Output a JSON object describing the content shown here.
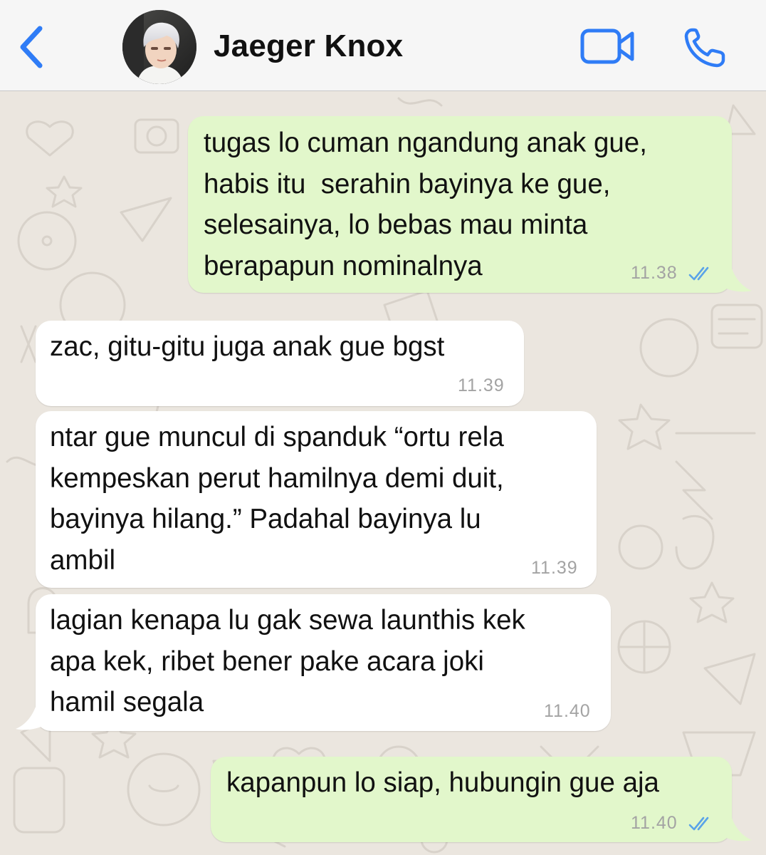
{
  "header": {
    "back_icon": "chevron-left-icon",
    "contact_name": "Jaeger Knox",
    "video_icon": "video-camera-icon",
    "call_icon": "phone-icon",
    "accent_color": "#2f7cf6"
  },
  "messages": [
    {
      "direction": "outgoing",
      "text": "tugas lo cuman ngandung anak gue,\nhabis itu  serahin bayinya ke gue,\nselesainya, lo bebas mau minta\nberapapun nominalnya",
      "time": "11.38",
      "status": "read",
      "status_icon": "double-check-icon"
    },
    {
      "direction": "incoming",
      "text": "zac, gitu-gitu juga anak gue bgst",
      "time": "11.39"
    },
    {
      "direction": "incoming",
      "text": "ntar gue muncul di spanduk “ortu rela\nkempeskan perut hamilnya demi duit,\nbayinya hilang.” Padahal bayinya lu\nambil",
      "time": "11.39"
    },
    {
      "direction": "incoming",
      "text": "lagian kenapa lu gak sewa launthis kek\napa kek, ribet bener pake acara joki\nhamil segala",
      "time": "11.40"
    },
    {
      "direction": "outgoing",
      "text": "kapanpun lo siap, hubungin gue aja",
      "time": "11.40",
      "status": "read",
      "status_icon": "double-check-icon"
    }
  ],
  "colors": {
    "outgoing_bubble": "#e2f7cb",
    "incoming_bubble": "#ffffff",
    "chat_background": "#ebe6df",
    "read_ticks": "#5aa3e8"
  }
}
